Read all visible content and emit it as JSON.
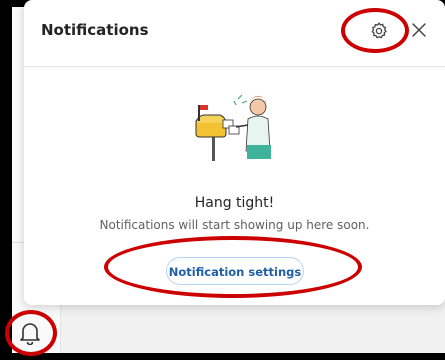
{
  "panel": {
    "title": "Notifications",
    "settings_icon": "gear-icon",
    "close_icon": "close-icon"
  },
  "empty_state": {
    "title": "Hang tight!",
    "subtitle": "Notifications will start showing up here soon.",
    "button_label": "Notification settings",
    "illustration": "mailbox-illustration"
  },
  "taskbar": {
    "bell_icon": "bell-icon"
  },
  "colors": {
    "annotation_red": "#cc0000",
    "accent_blue": "#1f5fa9",
    "button_border": "#b9d4f0"
  }
}
